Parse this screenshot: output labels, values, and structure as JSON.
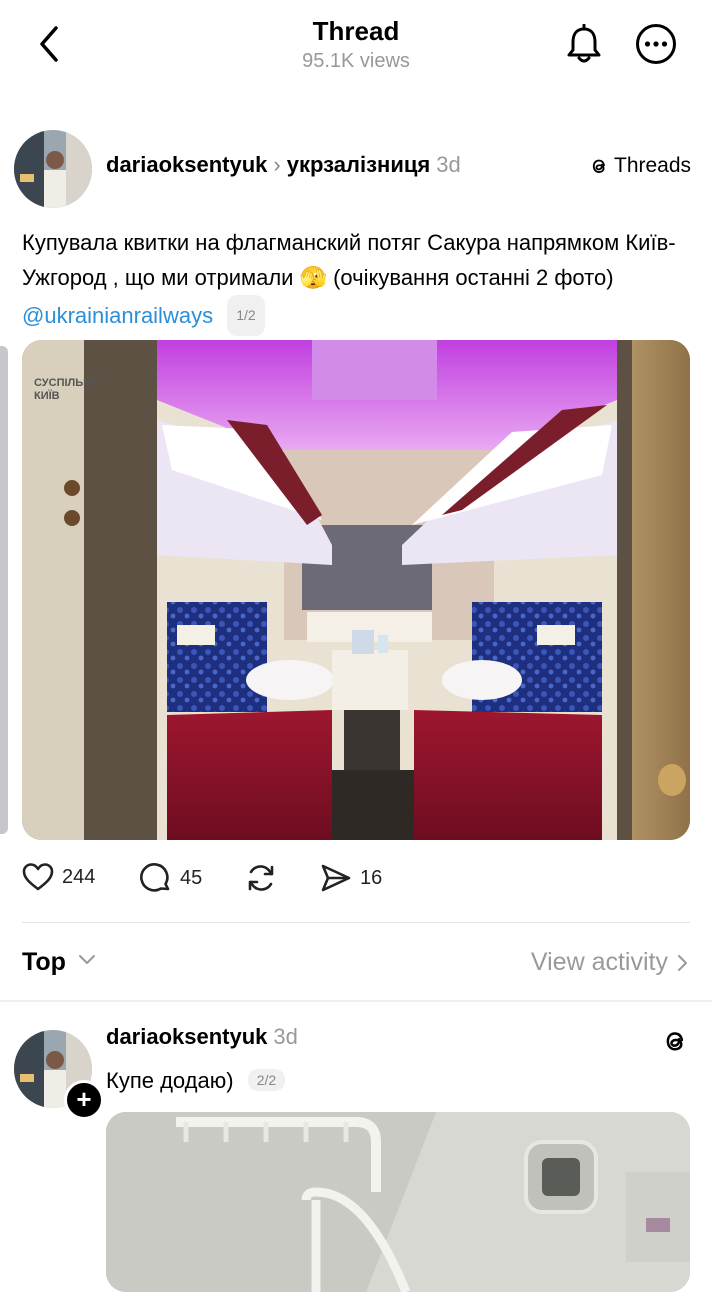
{
  "header": {
    "title": "Thread",
    "views": "95.1K views"
  },
  "post": {
    "username": "dariaoksentyuk",
    "community": "укрзалізниця",
    "time": "3d",
    "app_badge": "Threads",
    "text": "Купувала квитки на флагманский потяг Сакура напрямком Київ-Ужгород , що ми отримали 🫣 (очікування останні 2 фото)",
    "mention": "@ukrainianrailways",
    "pager": "1/2",
    "watermark_line1": "СУСПІЛЬНЕ",
    "watermark_line2": "КИЇВ",
    "likes": "244",
    "replies": "45",
    "shares": "16"
  },
  "sort": {
    "label": "Top",
    "view_activity": "View activity"
  },
  "reply": {
    "username": "dariaoksentyuk",
    "time": "3d",
    "text": "Купе додаю)",
    "pager": "2/2"
  },
  "icons": {
    "back": "chevron-left-icon",
    "bell": "bell-icon",
    "more": "more-icon",
    "like": "heart-icon",
    "reply": "comment-icon",
    "repost": "repost-icon",
    "share": "send-icon"
  }
}
